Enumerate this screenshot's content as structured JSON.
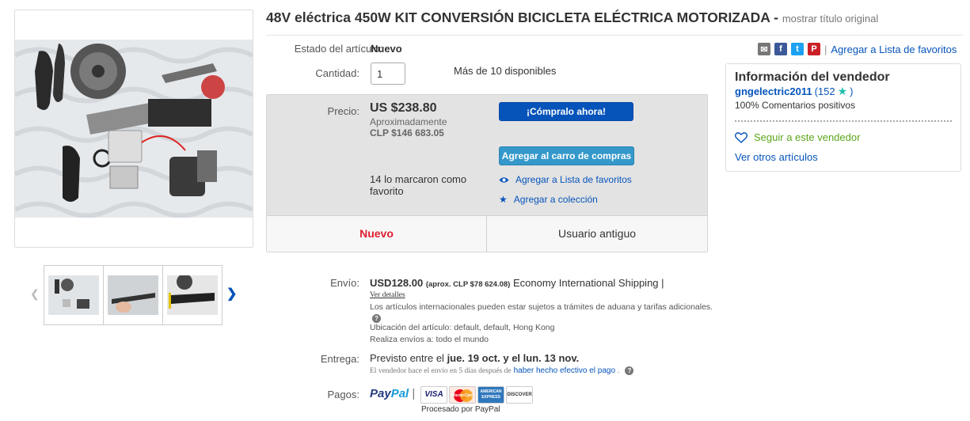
{
  "title": {
    "text": "48V eléctrica 450W KIT CONVERSIÓN BICICLETA ELÉCTRICA MOTORIZADA -",
    "original_link": "mostrar título original"
  },
  "gallery": {
    "prev_icon": "chevron-left-icon",
    "next_icon": "chevron-right-icon"
  },
  "condition": {
    "label": "Estado del artículo:",
    "value": "Nuevo"
  },
  "quantity": {
    "label": "Cantidad:",
    "value": "1",
    "availability": "Más de 10 disponibles"
  },
  "share": {
    "icons": [
      "email-icon",
      "facebook-icon",
      "twitter-icon",
      "pinterest-icon"
    ],
    "separator": "|",
    "watchlist_link": "Agregar a Lista de favoritos"
  },
  "price": {
    "label": "Precio:",
    "amount": "US $238.80",
    "approx_label": "Aproximadamente",
    "approx_value": "CLP $146 683.05",
    "buy_now": "¡Cómpralo ahora!",
    "add_to_cart": "Agregar al carro de compras",
    "watchers": "14 lo marcaron como favorito",
    "add_watchlist": "Agregar a Lista de favoritos",
    "add_collection": "Agregar a colección",
    "badge_new": "Nuevo",
    "badge_seller": "Usuario antiguo"
  },
  "seller": {
    "heading": "Información del vendedor",
    "name": "gngelectric2011",
    "score_open": "(152",
    "score_close": ")",
    "feedback": "100% Comentarios positivos",
    "follow": "Seguir a este vendedor",
    "other_items": "Ver otros artículos"
  },
  "shipping": {
    "label": "Envío:",
    "price": "USD128.00",
    "approx": "(aprox. CLP $78 624.08)",
    "service": "Economy International Shipping |",
    "details_link": "Ver detalles",
    "customs_note": "Los artículos internacionales pueden estar sujetos a trámites de aduana y tarifas adicionales.",
    "location": "Ubicación del artículo:  default, default, Hong Kong",
    "ships_to": "Realiza envíos a:  todo el mundo"
  },
  "delivery": {
    "label": "Entrega:",
    "prefix": "Previsto entre el",
    "dates": "jue. 19 oct. y el lun. 13 nov.",
    "note_prefix": "El vendedor hace el envío en 5 días después de",
    "note_link": "haber hecho efectivo el pago",
    "note_suffix": "."
  },
  "payments": {
    "label": "Pagos:",
    "paypal_a": "Pay",
    "paypal_b": "Pal",
    "separator": "|",
    "cards": [
      "VISA",
      "MasterCard",
      "AMERICAN EXPRESS",
      "DISCOVER"
    ],
    "processed_by": "Procesado por PayPal"
  },
  "colors": {
    "link": "#0654ba",
    "buy_now": "#0654ba",
    "add_to_cart": "#3498ca",
    "badge_new": "#dd1e31",
    "follow_green": "#5ba71b"
  }
}
